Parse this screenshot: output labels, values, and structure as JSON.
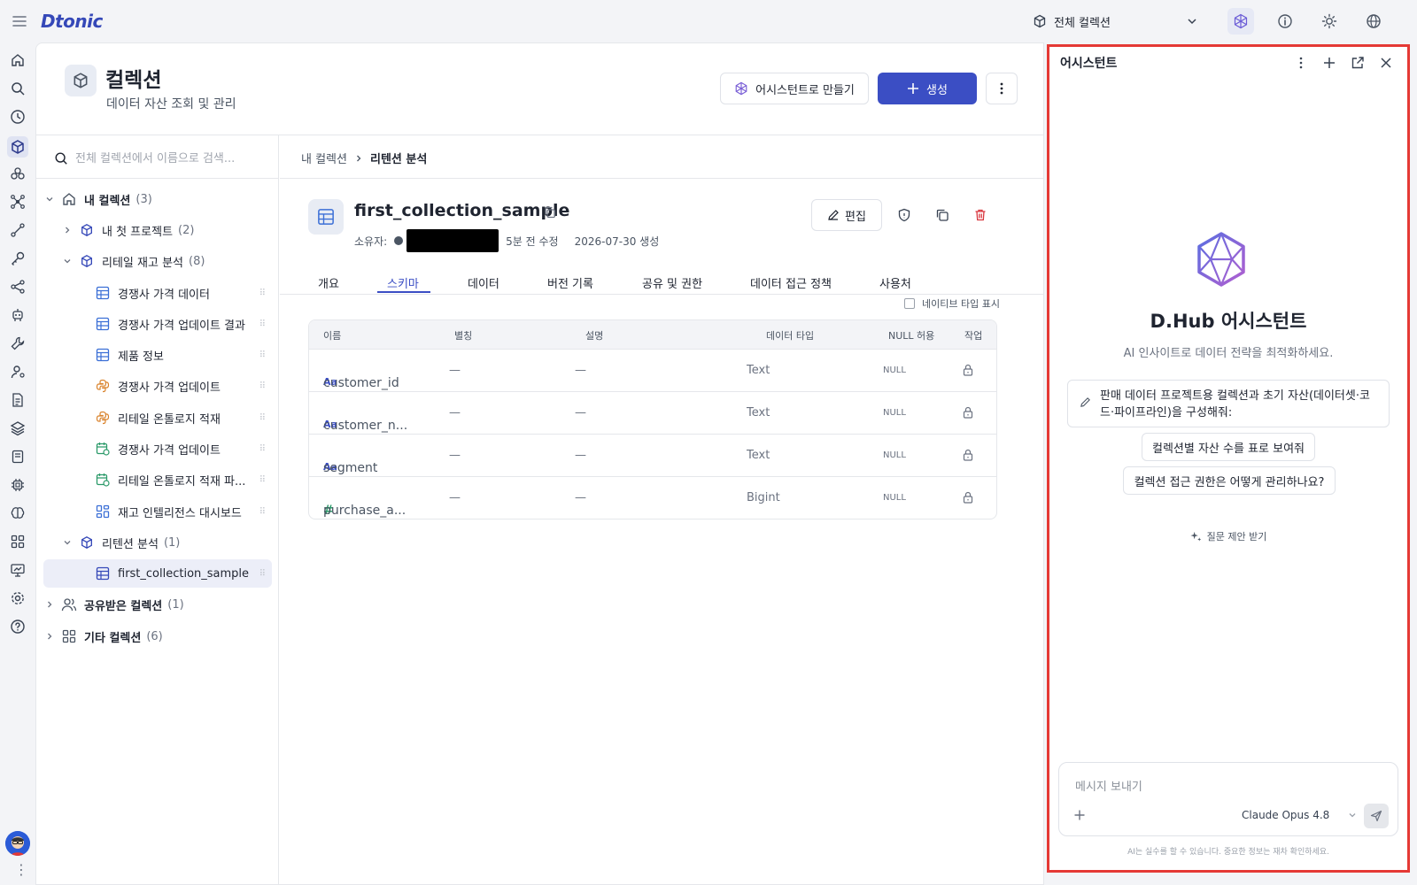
{
  "brand": {
    "logo": "Dtonic"
  },
  "topbar": {
    "collection_select": "전체 컬렉션",
    "icons": [
      "menu-icon",
      "assistant-gem-icon",
      "info-icon",
      "sun-icon",
      "globe-icon"
    ]
  },
  "rail": {
    "icons": [
      "home-icon",
      "search-icon",
      "clock-icon",
      "cube-icon",
      "cluster-icon",
      "network-icon",
      "pipeline-icon",
      "key-icon",
      "share-icon",
      "robot-icon",
      "tools-icon",
      "user-icon",
      "document-icon",
      "layers-icon",
      "notebook-icon",
      "chip-icon",
      "brain-icon",
      "grid-icon",
      "monitor-icon",
      "settings-icon",
      "help-icon"
    ]
  },
  "header": {
    "title": "컬렉션",
    "subtitle": "데이터 자산 조회 및 관리",
    "assist_button": "어시스턴트로 만들기",
    "create_button": "생성"
  },
  "tree": {
    "search_placeholder": "전체 컬렉션에서 이름으로 검색...",
    "items": [
      {
        "label": "내 컬렉션",
        "count": "(3)"
      },
      {
        "label": "내 첫 프로젝트",
        "count": "(2)"
      },
      {
        "label": "리테일 재고 분석",
        "count": "(8)"
      },
      {
        "label": "경쟁사 가격 데이터"
      },
      {
        "label": "경쟁사 가격 업데이트 결과"
      },
      {
        "label": "제품 정보"
      },
      {
        "label": "경쟁사 가격 업데이트"
      },
      {
        "label": "리테일 온톨로지 적재"
      },
      {
        "label": "경쟁사 가격 업데이트"
      },
      {
        "label": "리테일 온톨로지 적재 파..."
      },
      {
        "label": "재고 인텔리전스 대시보드"
      },
      {
        "label": "리텐션 분석",
        "count": "(1)"
      },
      {
        "label": "first_collection_sample"
      },
      {
        "label": "공유받은 컬렉션",
        "count": "(1)"
      },
      {
        "label": "기타 컬렉션",
        "count": "(6)"
      }
    ]
  },
  "detail": {
    "breadcrumb": [
      "내 컬렉션",
      "리텐션 분석"
    ],
    "title": "first_collection_sample",
    "owner_label": "소유자:",
    "modified": "5분 전 수정",
    "created": "2026-07-30 생성",
    "edit_button": "편집",
    "tabs": [
      "개요",
      "스키마",
      "데이터",
      "버전 기록",
      "공유 및 권한",
      "데이터 접근 정책",
      "사용처"
    ],
    "active_tab": "스키마",
    "native_type_toggle": "네이티브 타입 표시",
    "schema": {
      "headers": [
        "이름",
        "별칭",
        "설명",
        "데이터 타입",
        "NULL 허용",
        "작업"
      ],
      "rows": [
        {
          "type_icon": "Aa",
          "name": "customer_id",
          "alias": "—",
          "desc": "—",
          "dtype": "Text",
          "null": "NULL"
        },
        {
          "type_icon": "Aa",
          "name": "customer_n...",
          "alias": "—",
          "desc": "—",
          "dtype": "Text",
          "null": "NULL"
        },
        {
          "type_icon": "Aa",
          "name": "segment",
          "alias": "—",
          "desc": "—",
          "dtype": "Text",
          "null": "NULL"
        },
        {
          "type_icon": "#",
          "name": "purchase_a...",
          "alias": "—",
          "desc": "—",
          "dtype": "Bigint",
          "null": "NULL"
        }
      ]
    }
  },
  "assistant": {
    "title": "어시스턴트",
    "heading": "D.Hub 어시스턴트",
    "subheading": "AI 인사이트로 데이터 전략을 최적화하세요.",
    "suggestions": [
      "판매 데이터 프로젝트용 컬렉션과 초기 자산(데이터셋·코드·파이프라인)을 구성해줘:",
      "컬렉션별 자산 수를 표로 보여줘",
      "컬렉션 접근 권한은 어떻게 관리하나요?"
    ],
    "suggest_link": "질문 제안 받기",
    "input_placeholder": "메시지 보내기",
    "model": "Claude Opus 4.8",
    "disclaimer": "AI는 실수를 할 수 있습니다. 중요한 정보는 재차 확인하세요."
  },
  "colors": {
    "accent": "#3b4ec4",
    "highlight_border": "#e53935",
    "brand": "#3548b8"
  }
}
